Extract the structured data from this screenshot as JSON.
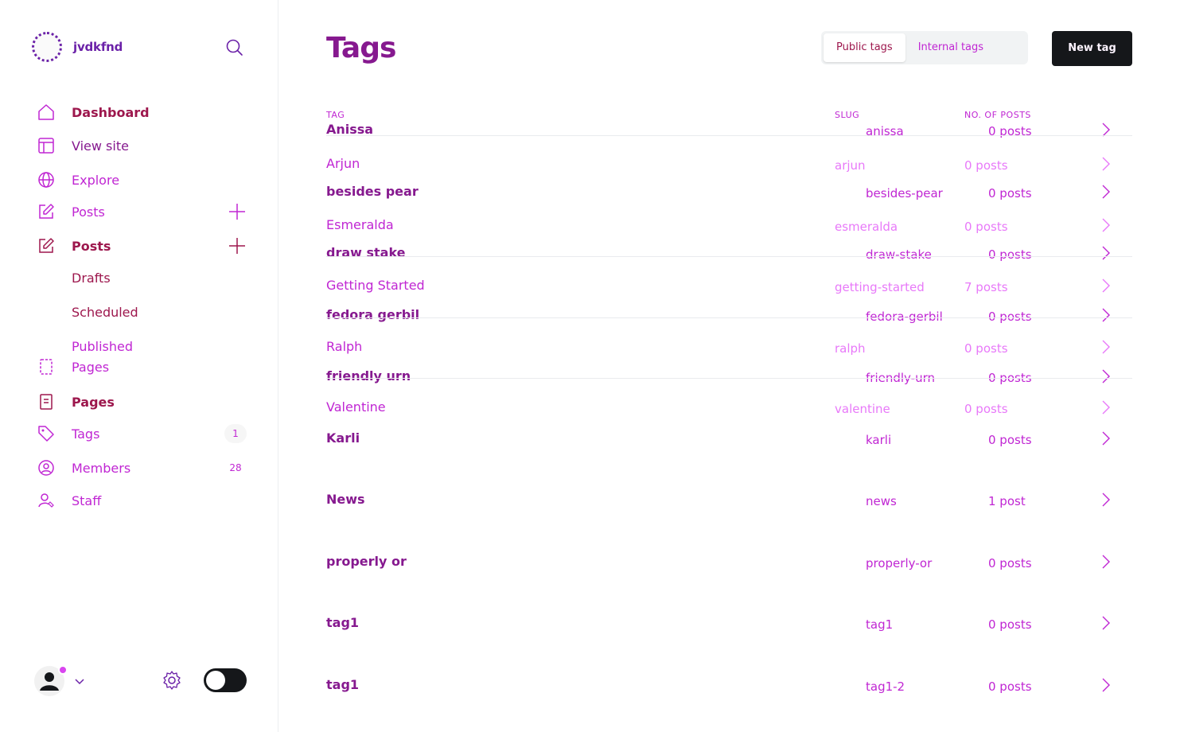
{
  "brand": {
    "name": "jvdkfnd"
  },
  "nav": {
    "dashboard": "Dashboard",
    "view_site": "View site",
    "explore": "Explore",
    "posts": "Posts",
    "posts_bold": "Posts",
    "drafts": "Drafts",
    "scheduled": "Scheduled",
    "published": "Published",
    "pages": "Pages",
    "pages_bold": "Pages",
    "tags": "Tags",
    "tags_count": "1",
    "members": "Members",
    "members_count": "28",
    "staff": "Staff"
  },
  "header": {
    "title": "Tags",
    "public_tags": "Public tags",
    "internal_tags": "Internal tags",
    "new_tag": "New tag"
  },
  "columns": {
    "tag": "TAG",
    "slug": "SLUG",
    "posts": "NO. OF POSTS"
  },
  "tags": [
    {
      "name": "Anissa",
      "slug": "anissa",
      "count": "0 posts"
    },
    {
      "name": "Arjun",
      "slug": "arjun",
      "count": "0 posts"
    },
    {
      "name": "besides pear",
      "slug": "besides-pear",
      "count": "0 posts"
    },
    {
      "name": "Esmeralda",
      "slug": "esmeralda",
      "count": "0 posts"
    },
    {
      "name": "draw stake",
      "slug": "draw-stake",
      "count": "0 posts"
    },
    {
      "name": "Getting Started",
      "slug": "getting-started",
      "count": "7 posts"
    },
    {
      "name": "fedora gerbil",
      "slug": "fedora-gerbil",
      "count": "0 posts"
    },
    {
      "name": "Ralph",
      "slug": "ralph",
      "count": "0 posts"
    },
    {
      "name": "friendly urn",
      "slug": "friendly-urn",
      "count": "0 posts"
    },
    {
      "name": "Valentine",
      "slug": "valentine",
      "count": "0 posts"
    },
    {
      "name": "Karli",
      "slug": "karli",
      "count": "0 posts"
    },
    {
      "name": "News",
      "slug": "news",
      "count": "1 post"
    },
    {
      "name": "properly or",
      "slug": "properly-or",
      "count": "0 posts"
    },
    {
      "name": "tag1",
      "slug": "tag1",
      "count": "0 posts"
    },
    {
      "name": "tag1",
      "slug": "tag1-2",
      "count": "0 posts"
    }
  ],
  "colors": {
    "accent": "#c026d3",
    "dark": "#86198f",
    "button": "#15171a",
    "badge": "#d946ef"
  },
  "icons": [
    "home-icon",
    "layout-icon",
    "globe-icon",
    "edit-icon",
    "page-icon",
    "tag-icon",
    "members-icon",
    "staff-icon",
    "search-icon",
    "gear-icon",
    "chevron-right-icon",
    "plus-icon"
  ]
}
